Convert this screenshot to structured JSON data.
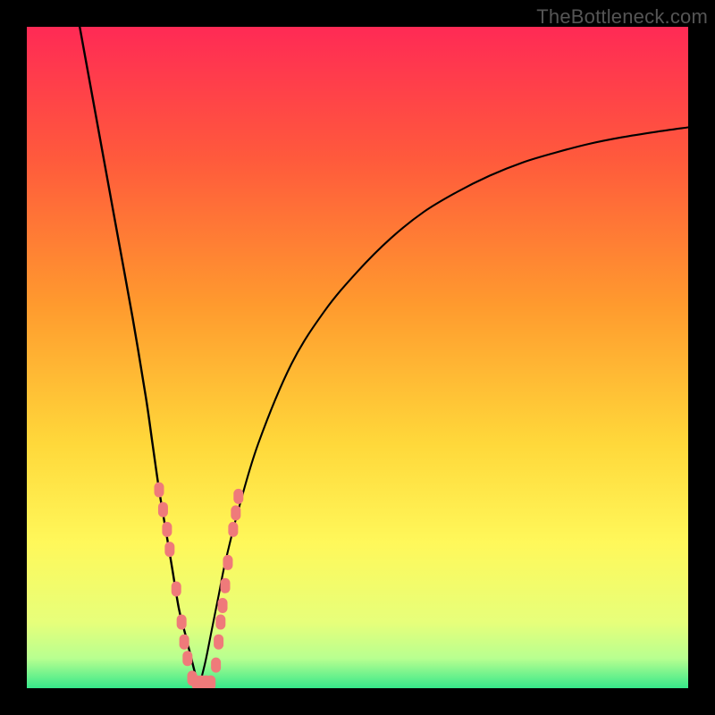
{
  "watermark": "TheBottleneck.com",
  "chart_data": {
    "type": "line",
    "title": "",
    "xlabel": "",
    "ylabel": "",
    "xlim": [
      0,
      100
    ],
    "ylim": [
      0,
      100
    ],
    "grid": false,
    "legend": false,
    "gradient_stops": [
      {
        "offset": 0.0,
        "color": "#ff2a55"
      },
      {
        "offset": 0.2,
        "color": "#ff5a3c"
      },
      {
        "offset": 0.42,
        "color": "#ff9a2e"
      },
      {
        "offset": 0.63,
        "color": "#ffd83a"
      },
      {
        "offset": 0.78,
        "color": "#fff85a"
      },
      {
        "offset": 0.9,
        "color": "#e7ff7a"
      },
      {
        "offset": 0.955,
        "color": "#b8ff90"
      },
      {
        "offset": 1.0,
        "color": "#36e88a"
      }
    ],
    "series": [
      {
        "name": "bottleneck-curve-left",
        "x": [
          8,
          10,
          12,
          14,
          16,
          18,
          19,
          20,
          21,
          22,
          23,
          24,
          25,
          26
        ],
        "values": [
          100,
          89,
          78,
          67,
          56,
          44,
          37,
          30,
          24,
          18,
          12,
          8,
          4,
          0
        ]
      },
      {
        "name": "bottleneck-curve-right",
        "x": [
          26,
          27,
          28,
          29,
          30,
          32,
          35,
          40,
          45,
          50,
          55,
          60,
          65,
          70,
          75,
          80,
          85,
          90,
          95,
          100
        ],
        "values": [
          0,
          4,
          9,
          14,
          19,
          27,
          37,
          49,
          57,
          63,
          68,
          72,
          75,
          77.5,
          79.5,
          81,
          82.3,
          83.3,
          84.1,
          84.8
        ]
      }
    ],
    "markers": {
      "color": "#ef7a7a",
      "points": [
        {
          "x": 20.0,
          "y": 30
        },
        {
          "x": 20.6,
          "y": 27
        },
        {
          "x": 21.2,
          "y": 24
        },
        {
          "x": 21.6,
          "y": 21
        },
        {
          "x": 22.6,
          "y": 15
        },
        {
          "x": 23.4,
          "y": 10
        },
        {
          "x": 23.8,
          "y": 7
        },
        {
          "x": 24.3,
          "y": 4.5
        },
        {
          "x": 25.0,
          "y": 1.5
        },
        {
          "x": 25.7,
          "y": 0.8
        },
        {
          "x": 26.4,
          "y": 0.8
        },
        {
          "x": 27.1,
          "y": 0.8
        },
        {
          "x": 27.8,
          "y": 0.8
        },
        {
          "x": 28.6,
          "y": 3.5
        },
        {
          "x": 29.0,
          "y": 7
        },
        {
          "x": 29.3,
          "y": 10
        },
        {
          "x": 29.6,
          "y": 12.5
        },
        {
          "x": 30.0,
          "y": 15.5
        },
        {
          "x": 30.4,
          "y": 19
        },
        {
          "x": 31.2,
          "y": 24
        },
        {
          "x": 31.6,
          "y": 26.5
        },
        {
          "x": 32.0,
          "y": 29
        }
      ]
    }
  }
}
